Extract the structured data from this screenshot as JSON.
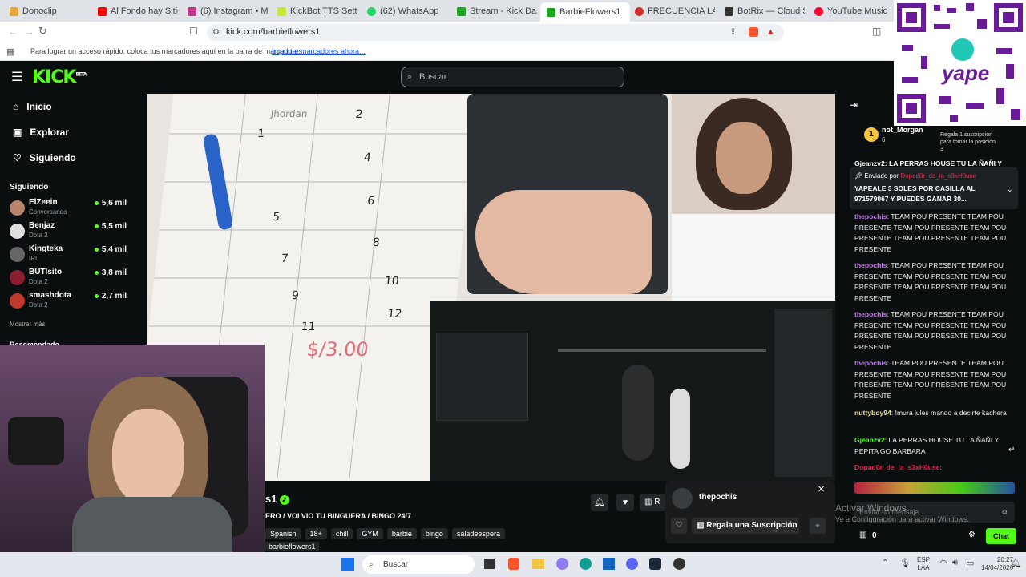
{
  "browser": {
    "tabs": [
      {
        "label": "Donoclip",
        "color": "#e8a73a"
      },
      {
        "label": "Al Fondo hay Sitio - Te",
        "color": "#ff0000"
      },
      {
        "label": "(6) Instagram • Mensa",
        "color": "#c13584"
      },
      {
        "label": "KickBot TTS Settings",
        "color": "#c6e83a"
      },
      {
        "label": "(62) WhatsApp",
        "color": "#25d366"
      },
      {
        "label": "Stream - Kick Dashbo",
        "color": "#1ea51e"
      },
      {
        "label": "BarbieFlowers1",
        "color": "#1ea51e"
      },
      {
        "label": "FRECUENCIA LATINA",
        "color": "#d32f2f"
      },
      {
        "label": "BotRix — Cloud Strea",
        "color": "#333333"
      },
      {
        "label": "YouTube Music",
        "color": "#ff0033"
      }
    ],
    "url": "kick.com/barbieflowers1",
    "bookmarks_text": "Para lograr un acceso rápido, coloca tus marcadores aquí en la barra de marcadores.",
    "bookmarks_link": "Importar marcadores ahora..."
  },
  "site": {
    "logo": "KICK",
    "logo_badge": "BETA",
    "search_placeholder": "Buscar",
    "nav": [
      {
        "label": "Inicio",
        "icon": "home-icon"
      },
      {
        "label": "Explorar",
        "icon": "compass-icon"
      },
      {
        "label": "Siguiendo",
        "icon": "heart-icon"
      }
    ],
    "following_title": "Siguiendo",
    "channels": [
      {
        "name": "ElZeein",
        "category": "Conversando",
        "viewers": "5,6 mil",
        "color": "#b7856a"
      },
      {
        "name": "Benjaz",
        "category": "Dota 2",
        "viewers": "5,5 mil",
        "color": "#e0e0e0"
      },
      {
        "name": "Kingteka",
        "category": "IRL",
        "viewers": "5,4 mil",
        "color": "#666666"
      },
      {
        "name": "BUTIsito",
        "category": "Dota 2",
        "viewers": "3,8 mil",
        "color": "#8a1e2e"
      },
      {
        "name": "smashdota",
        "category": "Dota 2",
        "viewers": "2,7 mil",
        "color": "#c0392b"
      }
    ],
    "show_more": "Mostrar más",
    "recommended": "Recomendado"
  },
  "stream": {
    "channel_suffix": "s1",
    "title": "ERO / VOLVIO TU BINGUERA / BINGO 24/7",
    "tags": [
      "Spanish",
      "18+",
      "chill",
      "GYM",
      "barbie",
      "bingo",
      "saladeespera"
    ],
    "channel_link": "barbieflowers1",
    "paper_numbers": [
      "2",
      "1",
      "4",
      "6",
      "5",
      "8",
      "7",
      "10",
      "9",
      "12",
      "11"
    ],
    "price_writing": "$/3.00",
    "paper_name": "Jhordan"
  },
  "popup": {
    "username": "thepochis",
    "gift_label": "Regala una Suscripción"
  },
  "chat": {
    "top_user": "not_Morgan",
    "top_count": "6",
    "gift_note": "Regala 1 suscripción para tomar la posición 3",
    "pinned_by_label": "Enviado por",
    "pinned_by_user": "Dopad0r_de_la_s3xH0use",
    "pinned_text": "YAPEALE 3 SOLES POR CASILLA AL 971579067 Y PUEDES GANAR 30...",
    "partial_msg": "Gjeanzv2: LA PERRAS HOUSE TU LA ÑAÑI Y",
    "messages": [
      {
        "user": "thepochis",
        "text": "TEAM POU PRESENTE TEAM POU PRESENTE TEAM POU PRESENTE TEAM POU PRESENTE TEAM POU PRESENTE TEAM POU PRESENTE"
      },
      {
        "user": "thepochis",
        "text": "TEAM POU PRESENTE TEAM POU PRESENTE TEAM POU PRESENTE TEAM POU PRESENTE TEAM POU PRESENTE TEAM POU PRESENTE"
      },
      {
        "user": "thepochis",
        "text": "TEAM POU PRESENTE TEAM POU PRESENTE TEAM POU PRESENTE TEAM POU PRESENTE TEAM POU PRESENTE TEAM POU PRESENTE"
      },
      {
        "user": "thepochis",
        "text": "TEAM POU PRESENTE TEAM POU PRESENTE TEAM POU PRESENTE TEAM POU PRESENTE TEAM POU PRESENTE TEAM POU PRESENTE"
      },
      {
        "user": "nuttyboy94",
        "text": "!mura jules mando a decirte kachera"
      },
      {
        "user": "Gjeanzv2",
        "text": "LA PERRAS HOUSE TU LA ÑAÑI Y PEPITA GO BARBARA"
      },
      {
        "user": "Dopad0r_de_la_s3xH0use",
        "text": ""
      }
    ],
    "input_placeholder": "Enviar un mensaje",
    "points": "0",
    "send_label": "Chat"
  },
  "overlay": {
    "yape_text": "yape",
    "windows_watermark_1": "Activar Windows",
    "windows_watermark_2": "Ve a Configuración para activar Windows."
  },
  "taskbar": {
    "search": "Buscar",
    "lang_1": "ESP",
    "lang_2": "LAA",
    "time": "20:27",
    "date": "14/04/2026"
  }
}
